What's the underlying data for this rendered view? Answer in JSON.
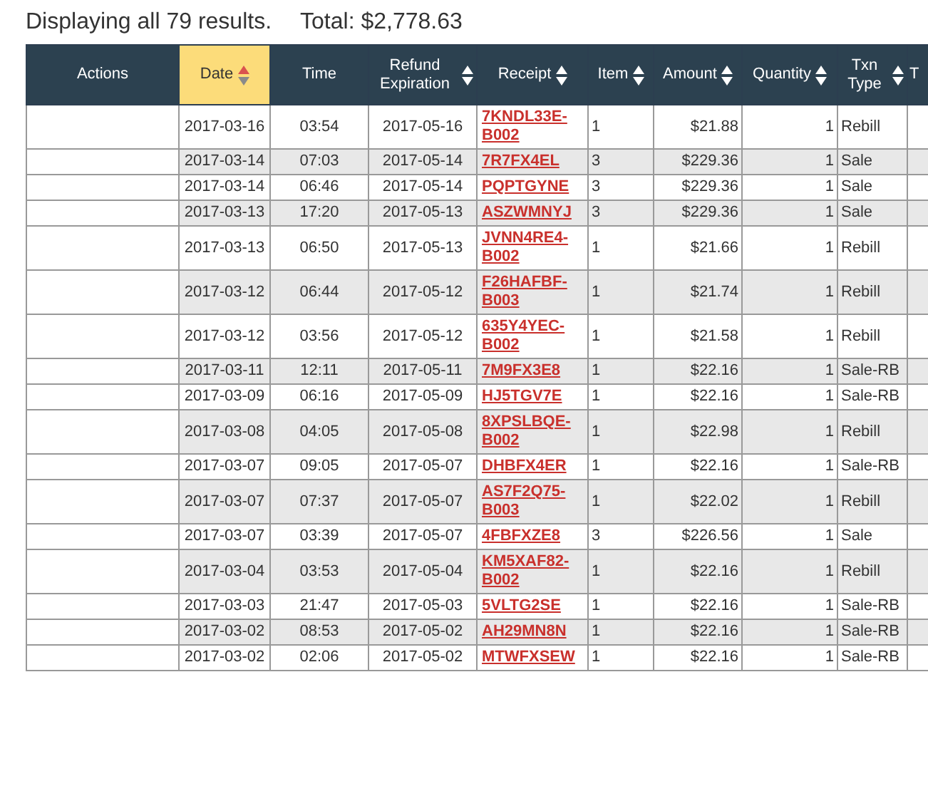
{
  "summary": {
    "count_text": "Displaying all 79 results.",
    "total_text": "Total: $2,778.63"
  },
  "table": {
    "columns": [
      {
        "label": "Actions",
        "sortable": false,
        "selected": false
      },
      {
        "label": "Date",
        "sortable": true,
        "selected": true
      },
      {
        "label": "Time",
        "sortable": false,
        "selected": false
      },
      {
        "label": "Refund Expiration",
        "sortable": true,
        "selected": false
      },
      {
        "label": "Receipt",
        "sortable": true,
        "selected": false
      },
      {
        "label": "Item",
        "sortable": true,
        "selected": false
      },
      {
        "label": "Amount",
        "sortable": true,
        "selected": false
      },
      {
        "label": "Quantity",
        "sortable": true,
        "selected": false
      },
      {
        "label": "Txn Type",
        "sortable": true,
        "selected": false
      },
      {
        "label": "T",
        "sortable": false,
        "selected": false
      }
    ],
    "rows": [
      {
        "date": "2017-03-16",
        "time": "03:54",
        "refund_expiration": "2017-05-16",
        "receipt": "7KNDL33E-B002",
        "item": "1",
        "amount": "$21.88",
        "quantity": "1",
        "txn_type": "Rebill"
      },
      {
        "date": "2017-03-14",
        "time": "07:03",
        "refund_expiration": "2017-05-14",
        "receipt": "7R7FX4EL",
        "item": "3",
        "amount": "$229.36",
        "quantity": "1",
        "txn_type": "Sale"
      },
      {
        "date": "2017-03-14",
        "time": "06:46",
        "refund_expiration": "2017-05-14",
        "receipt": "PQPTGYNE",
        "item": "3",
        "amount": "$229.36",
        "quantity": "1",
        "txn_type": "Sale"
      },
      {
        "date": "2017-03-13",
        "time": "17:20",
        "refund_expiration": "2017-05-13",
        "receipt": "ASZWMNYJ",
        "item": "3",
        "amount": "$229.36",
        "quantity": "1",
        "txn_type": "Sale"
      },
      {
        "date": "2017-03-13",
        "time": "06:50",
        "refund_expiration": "2017-05-13",
        "receipt": "JVNN4RE4-B002",
        "item": "1",
        "amount": "$21.66",
        "quantity": "1",
        "txn_type": "Rebill"
      },
      {
        "date": "2017-03-12",
        "time": "06:44",
        "refund_expiration": "2017-05-12",
        "receipt": "F26HAFBF-B003",
        "item": "1",
        "amount": "$21.74",
        "quantity": "1",
        "txn_type": "Rebill"
      },
      {
        "date": "2017-03-12",
        "time": "03:56",
        "refund_expiration": "2017-05-12",
        "receipt": "635Y4YEC-B002",
        "item": "1",
        "amount": "$21.58",
        "quantity": "1",
        "txn_type": "Rebill"
      },
      {
        "date": "2017-03-11",
        "time": "12:11",
        "refund_expiration": "2017-05-11",
        "receipt": "7M9FX3E8",
        "item": "1",
        "amount": "$22.16",
        "quantity": "1",
        "txn_type": "Sale-RB"
      },
      {
        "date": "2017-03-09",
        "time": "06:16",
        "refund_expiration": "2017-05-09",
        "receipt": "HJ5TGV7E",
        "item": "1",
        "amount": "$22.16",
        "quantity": "1",
        "txn_type": "Sale-RB"
      },
      {
        "date": "2017-03-08",
        "time": "04:05",
        "refund_expiration": "2017-05-08",
        "receipt": "8XPSLBQE-B002",
        "item": "1",
        "amount": "$22.98",
        "quantity": "1",
        "txn_type": "Rebill"
      },
      {
        "date": "2017-03-07",
        "time": "09:05",
        "refund_expiration": "2017-05-07",
        "receipt": "DHBFX4ER",
        "item": "1",
        "amount": "$22.16",
        "quantity": "1",
        "txn_type": "Sale-RB"
      },
      {
        "date": "2017-03-07",
        "time": "07:37",
        "refund_expiration": "2017-05-07",
        "receipt": "AS7F2Q75-B003",
        "item": "1",
        "amount": "$22.02",
        "quantity": "1",
        "txn_type": "Rebill"
      },
      {
        "date": "2017-03-07",
        "time": "03:39",
        "refund_expiration": "2017-05-07",
        "receipt": "4FBFXZE8",
        "item": "3",
        "amount": "$226.56",
        "quantity": "1",
        "txn_type": "Sale"
      },
      {
        "date": "2017-03-04",
        "time": "03:53",
        "refund_expiration": "2017-05-04",
        "receipt": "KM5XAF82-B002",
        "item": "1",
        "amount": "$22.16",
        "quantity": "1",
        "txn_type": "Rebill"
      },
      {
        "date": "2017-03-03",
        "time": "21:47",
        "refund_expiration": "2017-05-03",
        "receipt": "5VLTG2SE",
        "item": "1",
        "amount": "$22.16",
        "quantity": "1",
        "txn_type": "Sale-RB"
      },
      {
        "date": "2017-03-02",
        "time": "08:53",
        "refund_expiration": "2017-05-02",
        "receipt": "AH29MN8N",
        "item": "1",
        "amount": "$22.16",
        "quantity": "1",
        "txn_type": "Sale-RB"
      },
      {
        "date": "2017-03-02",
        "time": "02:06",
        "refund_expiration": "2017-05-02",
        "receipt": "MTWFXSEW",
        "item": "1",
        "amount": "$22.16",
        "quantity": "1",
        "txn_type": "Sale-RB"
      }
    ]
  }
}
